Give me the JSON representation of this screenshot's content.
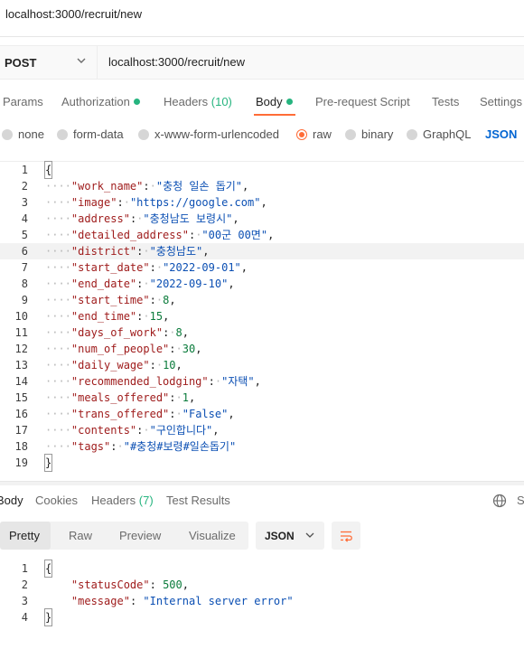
{
  "window": {
    "title": "localhost:3000/recruit/new"
  },
  "request": {
    "method": "POST",
    "url": "localhost:3000/recruit/new"
  },
  "tabs": [
    {
      "label": "Params"
    },
    {
      "label": "Authorization"
    },
    {
      "label": "Headers",
      "count": "(10)"
    },
    {
      "label": "Body"
    },
    {
      "label": "Pre-request Script"
    },
    {
      "label": "Tests"
    },
    {
      "label": "Settings"
    }
  ],
  "body_types": [
    {
      "label": "none"
    },
    {
      "label": "form-data"
    },
    {
      "label": "x-www-form-urlencoded"
    },
    {
      "label": "raw",
      "selected": true
    },
    {
      "label": "binary"
    },
    {
      "label": "GraphQL"
    },
    {
      "label": "JSON"
    }
  ],
  "request_body": {
    "line_numbers": [
      "1",
      "2",
      "3",
      "4",
      "5",
      "6",
      "7",
      "8",
      "9",
      "10",
      "11",
      "12",
      "13",
      "14",
      "15",
      "16",
      "17",
      "18",
      "19"
    ],
    "open": "{",
    "close": "}",
    "fields": [
      {
        "key": "\"work_name\"",
        "value": "\"충청 일손 돕기\"",
        "type": "string"
      },
      {
        "key": "\"image\"",
        "value": "\"https://google.com\"",
        "type": "string"
      },
      {
        "key": "\"address\"",
        "value": "\"충청남도 보령시\"",
        "type": "string"
      },
      {
        "key": "\"detailed_address\"",
        "value": "\"00군 00면\"",
        "type": "string"
      },
      {
        "key": "\"district\"",
        "value": "\"충청남도\"",
        "type": "string"
      },
      {
        "key": "\"start_date\"",
        "value": "\"2022-09-01\"",
        "type": "string"
      },
      {
        "key": "\"end_date\"",
        "value": "\"2022-09-10\"",
        "type": "string"
      },
      {
        "key": "\"start_time\"",
        "value": "8",
        "type": "number"
      },
      {
        "key": "\"end_time\"",
        "value": "15",
        "type": "number"
      },
      {
        "key": "\"days_of_work\"",
        "value": "8",
        "type": "number"
      },
      {
        "key": "\"num_of_people\"",
        "value": "30",
        "type": "number"
      },
      {
        "key": "\"daily_wage\"",
        "value": "10",
        "type": "number"
      },
      {
        "key": "\"recommended_lodging\"",
        "value": "\"자택\"",
        "type": "string"
      },
      {
        "key": "\"meals_offered\"",
        "value": "1",
        "type": "number"
      },
      {
        "key": "\"trans_offered\"",
        "value": "\"False\"",
        "type": "string"
      },
      {
        "key": "\"contents\"",
        "value": "\"구인합니다\"",
        "type": "string"
      },
      {
        "key": "\"tags\"",
        "value": "\"#충청#보령#일손돕기\"",
        "type": "string"
      }
    ]
  },
  "response_tabs": [
    {
      "label": "Body"
    },
    {
      "label": "Cookies"
    },
    {
      "label": "Headers",
      "count": "(7)"
    },
    {
      "label": "Test Results"
    }
  ],
  "response_corner": "S",
  "view_modes": [
    {
      "label": "Pretty"
    },
    {
      "label": "Raw"
    },
    {
      "label": "Preview"
    },
    {
      "label": "Visualize"
    }
  ],
  "format": {
    "label": "JSON"
  },
  "response_body": {
    "line_numbers": [
      "1",
      "2",
      "3",
      "4"
    ],
    "open": "{",
    "close": "}",
    "fields": [
      {
        "key": "\"statusCode\"",
        "value": "500",
        "type": "number"
      },
      {
        "key": "\"message\"",
        "value": "\"Internal server error\"",
        "type": "string"
      }
    ]
  },
  "colors": {
    "accent": "#ff6c37",
    "success": "#26b47f",
    "json_key": "#9e1a1a",
    "json_string": "#0b4fb3",
    "json_number": "#0a7b3b",
    "link": "#0265d2"
  },
  "icons": [
    "chevron-down-icon",
    "globe-icon",
    "wrap-lines-icon"
  ]
}
